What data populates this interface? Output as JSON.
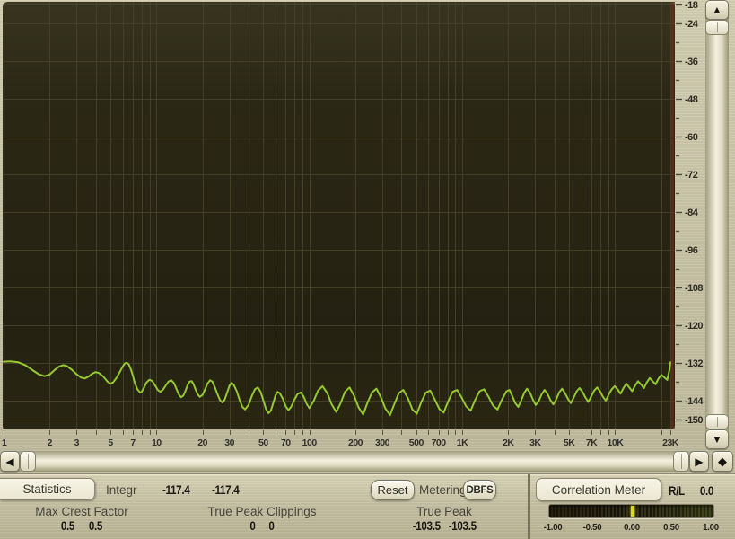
{
  "chart_data": {
    "type": "line",
    "x_scale": "log",
    "x_range": [
      1,
      23000
    ],
    "y_range": [
      -150,
      -18
    ],
    "bg": "#272413",
    "grid_color": "#454228",
    "edge_line_color": "#6b2d18",
    "freq_tick_values": [
      1,
      2,
      3,
      5,
      7,
      10,
      20,
      30,
      50,
      70,
      100,
      200,
      300,
      500,
      700,
      1000,
      2000,
      3000,
      5000,
      7000,
      10000,
      23000
    ],
    "freq_tick_labels": [
      "1",
      "2",
      "3",
      "5",
      "7",
      "10",
      "20",
      "30",
      "50",
      "70",
      "100",
      "200",
      "300",
      "500",
      "700",
      "1K",
      "2K",
      "3K",
      "5K",
      "7K",
      "10K",
      "23K"
    ],
    "db_tick_values": [
      -18,
      -24,
      -36,
      -48,
      -60,
      -72,
      -84,
      -96,
      -108,
      -120,
      -132,
      -144,
      -150
    ],
    "db_tick_labels": [
      "-18",
      "-24",
      "-36",
      "-48",
      "-60",
      "-72",
      "-84",
      "-96",
      "-108",
      "-120",
      "-132",
      "-144",
      "-150"
    ],
    "db_minor_step": 6,
    "series": [
      {
        "name": "spectrum",
        "color": "#96c832",
        "points": [
          [
            1,
            -131.6
          ],
          [
            1.1,
            -131.5
          ],
          [
            1.25,
            -131.8
          ],
          [
            1.4,
            -132.8
          ],
          [
            1.55,
            -134.3
          ],
          [
            1.7,
            -135.6
          ],
          [
            1.85,
            -136.2
          ],
          [
            2,
            -135.7
          ],
          [
            2.15,
            -134.3
          ],
          [
            2.3,
            -133.2
          ],
          [
            2.45,
            -132.7
          ],
          [
            2.6,
            -133
          ],
          [
            2.8,
            -134.2
          ],
          [
            3,
            -135.6
          ],
          [
            3.2,
            -136.6
          ],
          [
            3.4,
            -136.9
          ],
          [
            3.6,
            -136.3
          ],
          [
            3.8,
            -135.4
          ],
          [
            4,
            -134.9
          ],
          [
            4.2,
            -135.2
          ],
          [
            4.5,
            -136.4
          ],
          [
            4.8,
            -138
          ],
          [
            5,
            -138.6
          ],
          [
            5.2,
            -138.2
          ],
          [
            5.5,
            -136.6
          ],
          [
            5.8,
            -134.6
          ],
          [
            6,
            -133.2
          ],
          [
            6.2,
            -132.2
          ],
          [
            6.4,
            -131.9
          ],
          [
            6.6,
            -132.5
          ],
          [
            6.8,
            -134
          ],
          [
            7,
            -136
          ],
          [
            7.2,
            -138.2
          ],
          [
            7.5,
            -140.4
          ],
          [
            7.8,
            -141.4
          ],
          [
            8,
            -141.2
          ],
          [
            8.3,
            -139.8
          ],
          [
            8.6,
            -138.2
          ],
          [
            9,
            -137.3
          ],
          [
            9.4,
            -137.8
          ],
          [
            9.8,
            -139.2
          ],
          [
            10.2,
            -140.6
          ],
          [
            10.6,
            -141.2
          ],
          [
            11,
            -140.6
          ],
          [
            11.5,
            -139.2
          ],
          [
            12,
            -137.9
          ],
          [
            12.5,
            -137.5
          ],
          [
            13,
            -138.4
          ],
          [
            13.5,
            -140.2
          ],
          [
            14,
            -142
          ],
          [
            14.5,
            -142.9
          ],
          [
            15,
            -142.4
          ],
          [
            15.5,
            -140.8
          ],
          [
            16,
            -139
          ],
          [
            16.5,
            -137.9
          ],
          [
            17,
            -137.8
          ],
          [
            17.5,
            -138.8
          ],
          [
            18,
            -140.4
          ],
          [
            18.6,
            -142
          ],
          [
            19.2,
            -142.8
          ],
          [
            20,
            -142.2
          ],
          [
            20.8,
            -140.4
          ],
          [
            21.6,
            -138.5
          ],
          [
            22.4,
            -137.5
          ],
          [
            23.2,
            -137.9
          ],
          [
            24,
            -139.5
          ],
          [
            25,
            -141.8
          ],
          [
            26,
            -143.8
          ],
          [
            27,
            -144.6
          ],
          [
            28,
            -143.6
          ],
          [
            29,
            -141.4
          ],
          [
            30,
            -139.3
          ],
          [
            31,
            -138.3
          ],
          [
            32,
            -138.9
          ],
          [
            33.5,
            -141
          ],
          [
            35,
            -143.8
          ],
          [
            36.5,
            -146
          ],
          [
            38,
            -146.8
          ],
          [
            40,
            -145.4
          ],
          [
            42,
            -142.6
          ],
          [
            44,
            -140.4
          ],
          [
            46,
            -139.8
          ],
          [
            48,
            -141.2
          ],
          [
            50,
            -143.9
          ],
          [
            52,
            -146.6
          ],
          [
            54,
            -148
          ],
          [
            56,
            -147.2
          ],
          [
            58,
            -144.8
          ],
          [
            60,
            -142.4
          ],
          [
            62,
            -141.2
          ],
          [
            64,
            -141.6
          ],
          [
            67,
            -143.4
          ],
          [
            70,
            -145.8
          ],
          [
            73,
            -147
          ],
          [
            76,
            -146
          ],
          [
            80,
            -143.6
          ],
          [
            84,
            -141.8
          ],
          [
            88,
            -141.4
          ],
          [
            92,
            -142.8
          ],
          [
            96,
            -145
          ],
          [
            100,
            -146.4
          ],
          [
            107,
            -144
          ],
          [
            114,
            -140.8
          ],
          [
            122,
            -139.4
          ],
          [
            131,
            -141.6
          ],
          [
            140,
            -145.2
          ],
          [
            150,
            -147.6
          ],
          [
            160,
            -144.8
          ],
          [
            171,
            -141.2
          ],
          [
            183,
            -139.8
          ],
          [
            196,
            -142.4
          ],
          [
            210,
            -146.2
          ],
          [
            225,
            -148.4
          ],
          [
            240,
            -144.6
          ],
          [
            257,
            -141.4
          ],
          [
            275,
            -140.2
          ],
          [
            294,
            -143
          ],
          [
            315,
            -146.6
          ],
          [
            337,
            -148.6
          ],
          [
            360,
            -145
          ],
          [
            385,
            -141.6
          ],
          [
            412,
            -140.6
          ],
          [
            441,
            -143.2
          ],
          [
            472,
            -146.8
          ],
          [
            505,
            -148.2
          ],
          [
            540,
            -144.4
          ],
          [
            578,
            -141.4
          ],
          [
            618,
            -140.8
          ],
          [
            661,
            -143.6
          ],
          [
            707,
            -146.6
          ],
          [
            757,
            -147.8
          ],
          [
            810,
            -144.2
          ],
          [
            866,
            -141.2
          ],
          [
            927,
            -140.6
          ],
          [
            992,
            -143
          ],
          [
            1061,
            -145.8
          ],
          [
            1135,
            -147.2
          ],
          [
            1214,
            -143.8
          ],
          [
            1299,
            -141
          ],
          [
            1390,
            -140.4
          ],
          [
            1487,
            -142.8
          ],
          [
            1591,
            -145.6
          ],
          [
            1702,
            -146.8
          ],
          [
            1821,
            -143.6
          ],
          [
            1949,
            -141
          ],
          [
            2037,
            -140.6
          ],
          [
            2129,
            -142.6
          ],
          [
            2225,
            -144.8
          ],
          [
            2325,
            -146
          ],
          [
            2430,
            -144
          ],
          [
            2539,
            -141.6
          ],
          [
            2653,
            -140.2
          ],
          [
            2772,
            -141.4
          ],
          [
            2897,
            -143.6
          ],
          [
            3027,
            -145.4
          ],
          [
            3163,
            -144.2
          ],
          [
            3306,
            -142
          ],
          [
            3455,
            -140.6
          ],
          [
            3610,
            -141.8
          ],
          [
            3772,
            -143.8
          ],
          [
            3942,
            -145.2
          ],
          [
            4119,
            -143.6
          ],
          [
            4305,
            -141.4
          ],
          [
            4499,
            -140.2
          ],
          [
            4701,
            -141.6
          ],
          [
            4913,
            -143.4
          ],
          [
            5134,
            -144.8
          ],
          [
            5365,
            -143
          ],
          [
            5607,
            -141
          ],
          [
            5859,
            -140
          ],
          [
            6123,
            -141.2
          ],
          [
            6398,
            -143
          ],
          [
            6686,
            -144.4
          ],
          [
            6987,
            -142.6
          ],
          [
            7301,
            -140.8
          ],
          [
            7630,
            -139.8
          ],
          [
            7973,
            -141
          ],
          [
            8332,
            -142.8
          ],
          [
            8707,
            -144
          ],
          [
            9099,
            -142
          ],
          [
            9508,
            -140.4
          ],
          [
            9936,
            -139.4
          ],
          [
            10383,
            -140.4
          ],
          [
            10850,
            -141.8
          ],
          [
            11338,
            -140
          ],
          [
            11848,
            -138.6
          ],
          [
            12381,
            -139.8
          ],
          [
            12938,
            -141
          ],
          [
            13520,
            -139.2
          ],
          [
            14128,
            -137.8
          ],
          [
            14764,
            -138.8
          ],
          [
            15428,
            -140
          ],
          [
            16122,
            -138.2
          ],
          [
            16848,
            -136.8
          ],
          [
            17606,
            -137.8
          ],
          [
            18398,
            -138.8
          ],
          [
            19226,
            -137
          ],
          [
            20091,
            -135.8
          ],
          [
            20995,
            -136.6
          ],
          [
            21940,
            -137.4
          ],
          [
            22500,
            -135
          ],
          [
            22800,
            -133.4
          ],
          [
            23000,
            -131.8
          ]
        ]
      }
    ]
  },
  "statistics": {
    "tab_label": "Statistics",
    "integr_label": "Integr",
    "integr_l": "-117.4",
    "integr_r": "-117.4",
    "reset_button": "Reset",
    "metering_label": "Metering",
    "metering_mode": "DBFS",
    "max_crest_label": "Max Crest Factor",
    "max_crest_l": "0.5",
    "max_crest_r": "0.5",
    "clippings_label": "True Peak Clippings",
    "clippings_l": "0",
    "clippings_r": "0",
    "true_peak_label": "True Peak",
    "true_peak_l": "-103.5",
    "true_peak_r": "-103.5"
  },
  "correlation": {
    "tab_label": "Correlation Meter",
    "channel_label": "R/L",
    "value": "0.0",
    "value_num": 0.0,
    "scale_labels": [
      "-1.00",
      "-0.50",
      "0.00",
      "0.50",
      "1.00"
    ],
    "indicator_color": "#d9d91f"
  },
  "icons": {
    "up": "▲",
    "down": "▼",
    "left": "◀",
    "right": "▶",
    "diamond": "◆"
  },
  "colors": {
    "chrome": "#c9c4a8",
    "display_bg": "#272413",
    "grid": "#454228",
    "spectrum_green": "#96c832",
    "edge_line": "#6b2d18",
    "indicator_yellow": "#d9d91f"
  }
}
